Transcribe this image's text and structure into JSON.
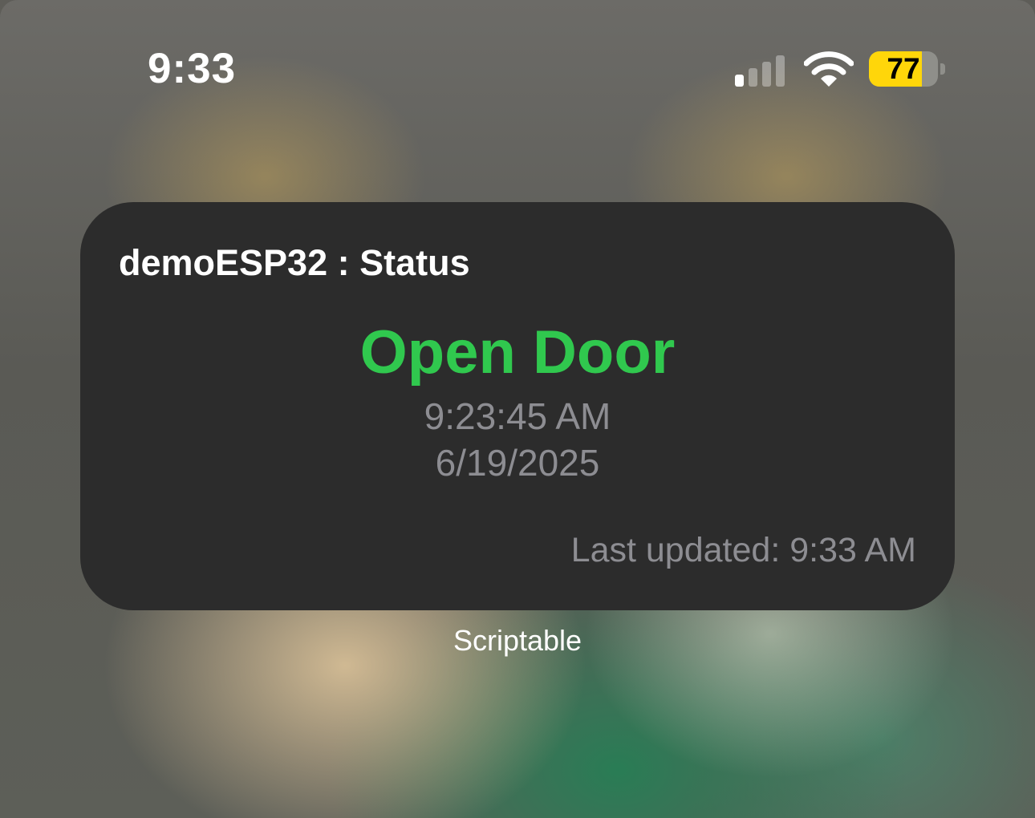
{
  "status_bar": {
    "time": "9:33",
    "signal_bars_active": 1,
    "signal_bars_total": 4,
    "signal_icon": "cellular-signal-icon",
    "wifi_icon": "wifi-icon",
    "battery_icon": "battery-icon",
    "battery_percent": "77",
    "battery_level": 0.77,
    "battery_color": "#ffd60a"
  },
  "widget": {
    "title": "demoESP32 : Status",
    "status": "Open Door",
    "status_color": "#30c84e",
    "event_time": "9:23:45 AM",
    "event_date": "6/19/2025",
    "last_updated": "Last updated: 9:33 AM"
  },
  "app_label": "Scriptable"
}
